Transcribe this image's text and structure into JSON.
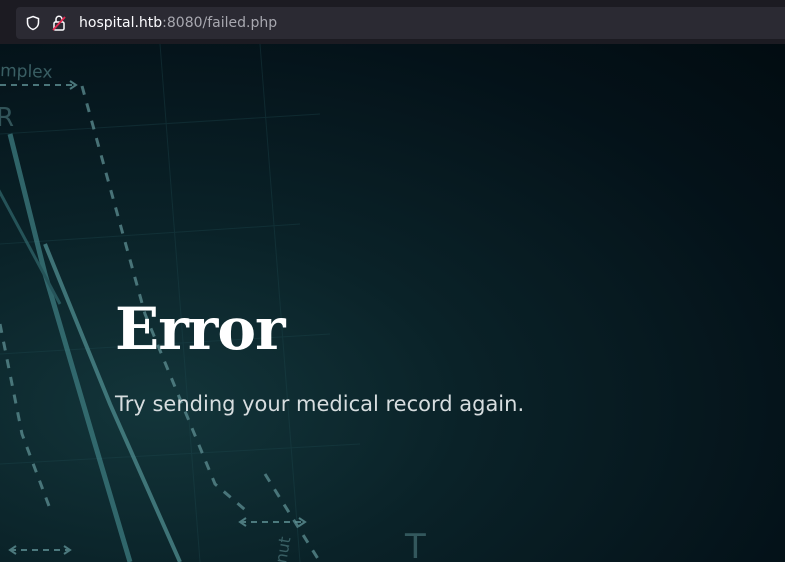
{
  "browser": {
    "url_host": "hospital.htb",
    "url_rest": ":8080/failed.php",
    "shield_icon": "shield-icon",
    "lock_icon": "lock-insecure-icon"
  },
  "page": {
    "title": "Error",
    "message": "Try sending your medical record again."
  },
  "background": {
    "decor_text_top": "mplex",
    "decor_letter_r": "R",
    "decor_letter_t": "T",
    "decor_text_bottom": "nut"
  },
  "colors": {
    "browser_bar": "#1c1b22",
    "url_field": "#2b2a33",
    "page_bg": "#0b1c22",
    "title": "#ffffff",
    "subtitle": "#d7dddf"
  }
}
